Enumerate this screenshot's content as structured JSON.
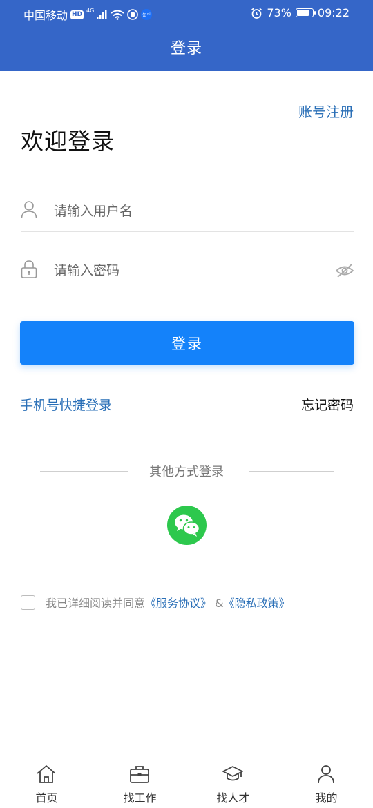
{
  "status_bar": {
    "carrier": "中国移动",
    "hd": "HD",
    "network": "4G",
    "app_badge": "知乎",
    "battery": "73%",
    "battery_level": 0.73,
    "time": "09:22"
  },
  "header": {
    "title": "登录"
  },
  "register_link": "账号注册",
  "welcome_title": "欢迎登录",
  "form": {
    "username_placeholder": "请输入用户名",
    "username_value": "",
    "password_placeholder": "请输入密码",
    "password_value": "",
    "submit_label": "登录"
  },
  "links": {
    "phone_login": "手机号快捷登录",
    "forgot_password": "忘记密码"
  },
  "other_login": {
    "label": "其他方式登录",
    "options": [
      "wechat-icon"
    ]
  },
  "agreement": {
    "checked": false,
    "prefix": "我已详细阅读并同意",
    "service_link": "《服务协议》",
    "connector": " &",
    "privacy_link": "《隐私政策》"
  },
  "tabbar": {
    "items": [
      {
        "label": "首页",
        "icon": "home-icon"
      },
      {
        "label": "找工作",
        "icon": "briefcase-icon"
      },
      {
        "label": "找人才",
        "icon": "graduation-cap-icon"
      },
      {
        "label": "我的",
        "icon": "user-icon"
      }
    ]
  },
  "colors": {
    "header_bg": "#3566c8",
    "primary_button": "#1482fa",
    "link": "#2a6fb7",
    "wechat": "#2dc84d"
  }
}
